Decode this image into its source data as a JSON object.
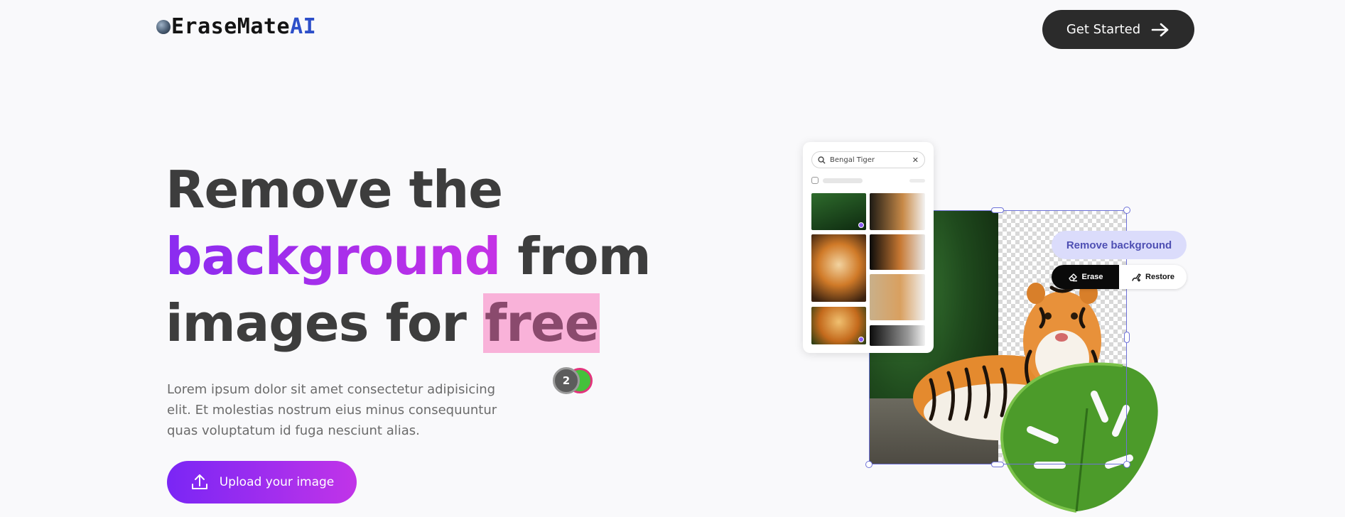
{
  "brand": {
    "name": "EraseMate",
    "suffix": "AI"
  },
  "header": {
    "cta_label": "Get Started"
  },
  "hero": {
    "line1": "Remove the",
    "line2_highlight": "background",
    "line2_rest": " from",
    "line3_start": "images for ",
    "line3_highlight": "free",
    "description": "Lorem ipsum dolor sit amet consectetur adipisicing elit. Et molestias nostrum eius minus consequuntur quas voluptatum id fuga nesciunt alias.",
    "upload_label": "Upload your image",
    "step_badge": "2"
  },
  "illustration": {
    "search_query": "Bengal Tiger",
    "remove_bg_label": "Remove background",
    "erase_label": "Erase",
    "restore_label": "Restore"
  },
  "colors": {
    "accent_purple": "#8a2cf0",
    "accent_magenta": "#c532e6",
    "highlight_pink": "#f9b2d9",
    "dark_button": "#2b2b2b",
    "selection_blue": "#6e72d8",
    "logo_ai_blue": "#2d4fc9"
  },
  "icons": [
    "globe-icon",
    "arrow-right-icon",
    "upload-icon",
    "search-icon",
    "close-icon",
    "eraser-icon",
    "restore-brush-icon"
  ]
}
